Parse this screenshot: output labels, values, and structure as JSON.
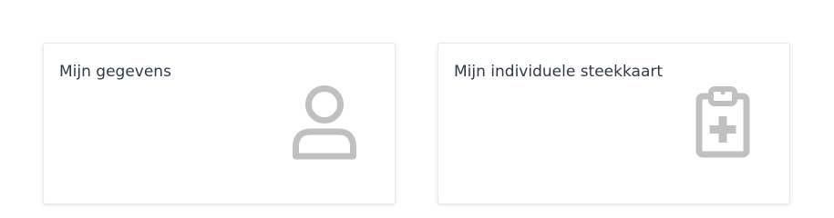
{
  "cards": [
    {
      "title": "Mijn gegevens",
      "icon": "user-icon"
    },
    {
      "title": "Mijn individuele steekkaart",
      "icon": "clipboard-medical-icon"
    }
  ],
  "colors": {
    "icon": "#c0c0c0",
    "title_text": "#2e3a47",
    "card_border": "#e9e9e9"
  }
}
